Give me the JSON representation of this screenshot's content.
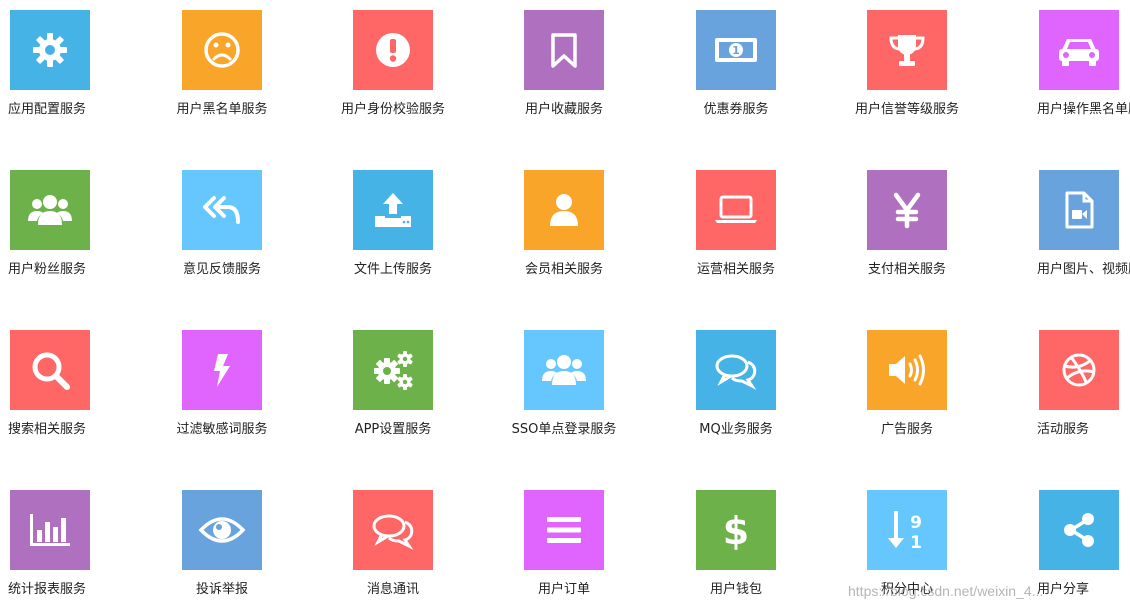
{
  "items": [
    {
      "label": "应用配置服务",
      "color": "#46b3e6",
      "icon": "gear-icon"
    },
    {
      "label": "用户黑名单服务",
      "color": "#f9a52a",
      "icon": "sad-face-icon"
    },
    {
      "label": "用户身份校验服务",
      "color": "#ff6666",
      "icon": "exclamation-icon"
    },
    {
      "label": "用户收藏服务",
      "color": "#b070c0",
      "icon": "bookmark-icon"
    },
    {
      "label": "优惠券服务",
      "color": "#69a3dd",
      "icon": "money-icon"
    },
    {
      "label": "用户信誉等级服务",
      "color": "#ff6666",
      "icon": "trophy-icon"
    },
    {
      "label": "用户操作黑名单服务",
      "color": "#e065ff",
      "icon": "car-icon"
    },
    {
      "label": "用户粉丝服务",
      "color": "#6cb14a",
      "icon": "group-icon"
    },
    {
      "label": "意见反馈服务",
      "color": "#66c7ff",
      "icon": "reply-all-icon"
    },
    {
      "label": "文件上传服务",
      "color": "#46b3e6",
      "icon": "upload-icon"
    },
    {
      "label": "会员相关服务",
      "color": "#f9a52a",
      "icon": "user-icon"
    },
    {
      "label": "运营相关服务",
      "color": "#ff6666",
      "icon": "laptop-icon"
    },
    {
      "label": "支付相关服务",
      "color": "#b070c0",
      "icon": "yen-icon"
    },
    {
      "label": "用户图片、视频服务",
      "color": "#69a3dd",
      "icon": "video-file-icon"
    },
    {
      "label": "搜索相关服务",
      "color": "#ff6666",
      "icon": "search-icon"
    },
    {
      "label": "过滤敏感词服务",
      "color": "#e065ff",
      "icon": "bolt-icon"
    },
    {
      "label": "APP设置服务",
      "color": "#6cb14a",
      "icon": "gears-icon"
    },
    {
      "label": "SSO单点登录服务",
      "color": "#66c7ff",
      "icon": "group-icon"
    },
    {
      "label": "MQ业务服务",
      "color": "#46b3e6",
      "icon": "comments-icon"
    },
    {
      "label": "广告服务",
      "color": "#f9a52a",
      "icon": "volume-icon"
    },
    {
      "label": "活动服务",
      "color": "#ff6666",
      "icon": "dribbble-icon"
    },
    {
      "label": "统计报表服务",
      "color": "#b070c0",
      "icon": "bar-chart-icon"
    },
    {
      "label": "投诉举报",
      "color": "#69a3dd",
      "icon": "eye-icon"
    },
    {
      "label": "消息通讯",
      "color": "#ff6666",
      "icon": "comments-icon"
    },
    {
      "label": "用户订单",
      "color": "#e065ff",
      "icon": "list-icon"
    },
    {
      "label": "用户钱包",
      "color": "#6cb14a",
      "icon": "dollar-icon"
    },
    {
      "label": "积分中心",
      "color": "#66c7ff",
      "icon": "sort-numeric-icon"
    },
    {
      "label": "用户分享",
      "color": "#46b3e6",
      "icon": "share-icon"
    }
  ],
  "watermark": "https://blog.csdn.net/weixin_4..."
}
